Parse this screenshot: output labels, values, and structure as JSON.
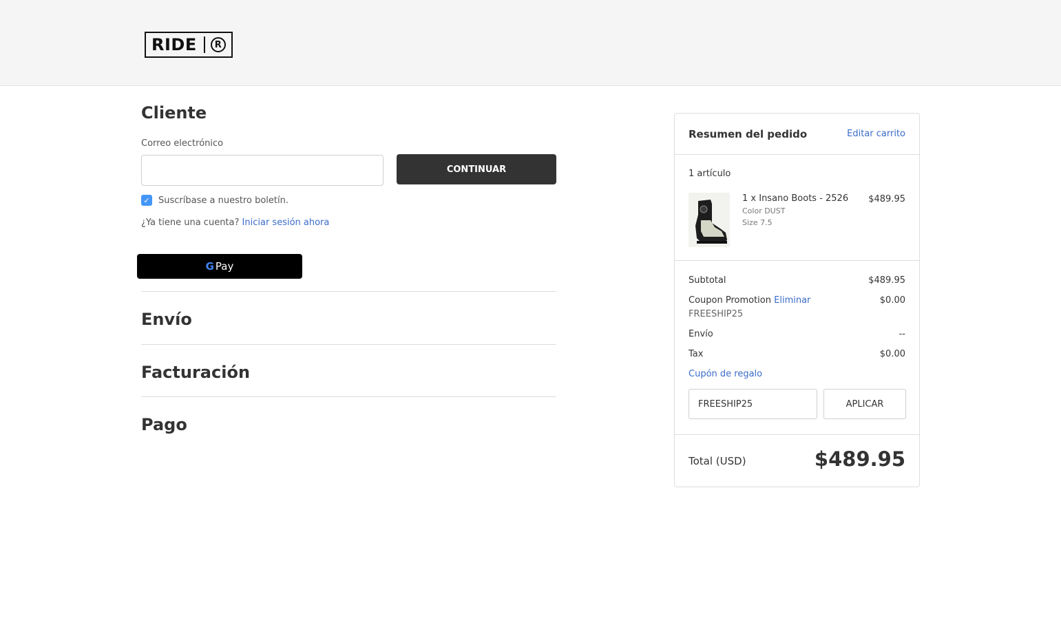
{
  "header": {
    "logo_text": "RIDE",
    "logo_mark": "R"
  },
  "customer": {
    "title": "Cliente",
    "email_label": "Correo electrónico",
    "email_value": "",
    "continue_label": "CONTINUAR",
    "newsletter_label": "Suscríbase a nuestro boletín.",
    "newsletter_checked": true,
    "account_prompt": "¿Ya tiene una cuenta?",
    "signin_link": "Iniciar sesión ahora",
    "gpay_letter": "G",
    "gpay_label": "Pay"
  },
  "steps": {
    "shipping": "Envío",
    "billing": "Facturación",
    "payment": "Pago"
  },
  "summary": {
    "title": "Resumen del pedido",
    "edit_cart": "Editar carrito",
    "item_count": "1 artículo",
    "item": {
      "name": "1 x Insano Boots - 2526",
      "price": "$489.95",
      "color": "Color DUST",
      "size": "Size 7.5"
    },
    "subtotal_label": "Subtotal",
    "subtotal_value": "$489.95",
    "coupon_label": "Coupon Promotion",
    "coupon_remove": "Eliminar",
    "coupon_code": "FREESHIP25",
    "coupon_value": "$0.00",
    "shipping_label": "Envío",
    "shipping_value": "--",
    "tax_label": "Tax",
    "tax_value": "$0.00",
    "gift_link": "Cupón de regalo",
    "gift_input_value": "FREESHIP25",
    "apply_label": "APLICAR",
    "total_label": "Total (USD)",
    "total_value": "$489.95"
  },
  "colors": {
    "link": "#3a6bc8",
    "primary_button": "#333333",
    "checkbox": "#4496f6",
    "header_bg": "#f5f5f5"
  }
}
